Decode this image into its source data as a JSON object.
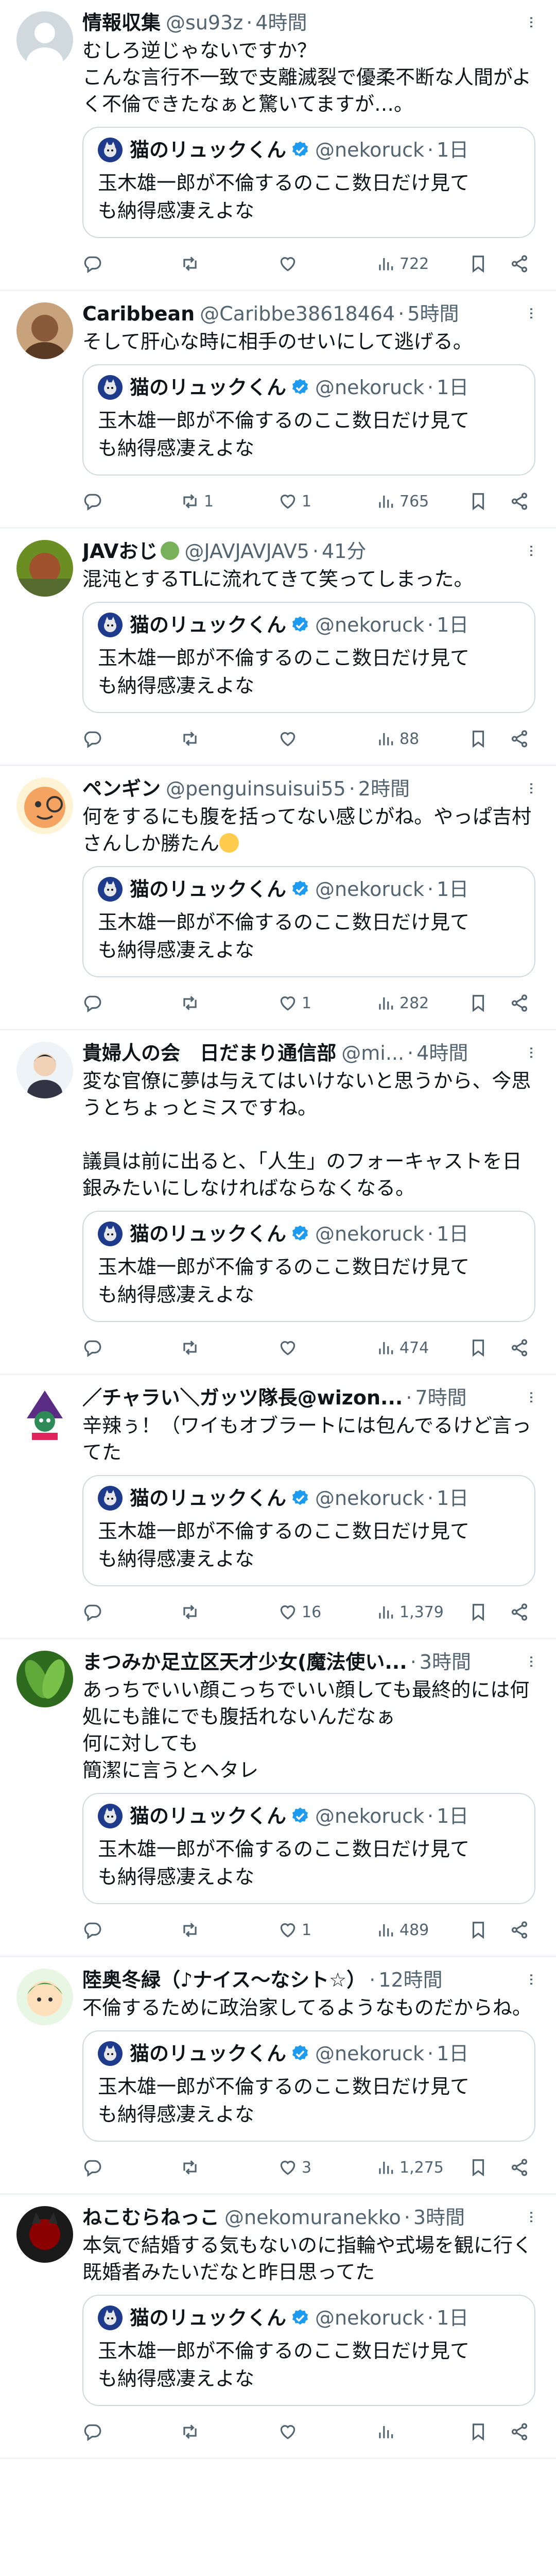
{
  "quoted": {
    "name": "猫のリュックくん",
    "handle": "@nekoruck",
    "sep": "·",
    "time": "1日",
    "text": "玉木雄一郎が不倫するのここ数日だけ見て\nも納得感凄えよな"
  },
  "icons": {
    "more": "more-dots-icon",
    "reply": "reply-icon",
    "retweet": "retweet-icon",
    "like": "heart-icon",
    "views": "views-chart-icon",
    "bookmark": "bookmark-icon",
    "share": "share-icon",
    "verified": "verified-badge-icon"
  },
  "colors": {
    "text": "#0f1419",
    "muted": "#536471",
    "border": "#cfd9de",
    "verified": "#1d9bf0"
  },
  "tweets": [
    {
      "name": "情報収集",
      "handle": "@su93z",
      "sep": "·",
      "time": "4時間",
      "text": "むしろ逆じゃないですか？\nこんな言行不一致で支離滅裂で優柔不断な人間がよく不倫できたなぁと驚いてますが…。",
      "reply_count": "",
      "retweet_count": "",
      "like_count": "",
      "views": "722"
    },
    {
      "name": "Caribbean",
      "handle": "@Caribbe38618464",
      "sep": "·",
      "time": "5時間",
      "text": "そして肝心な時に相手のせいにして逃げる。",
      "reply_count": "",
      "retweet_count": "1",
      "like_count": "1",
      "views": "765"
    },
    {
      "name": "JAVおじ",
      "handle": "@JAVJAVJAV5",
      "sep": "·",
      "time": "41分",
      "text": "混沌とするTLに流れてきて笑ってしまった。",
      "reply_count": "",
      "retweet_count": "",
      "like_count": "",
      "views": "88"
    },
    {
      "name": "ペンギン",
      "handle": "@penguinsuisui55",
      "sep": "·",
      "time": "2時間",
      "text": "何をするにも腹を括ってない感じがね。やっぱ吉村さんしか勝たん",
      "reply_count": "",
      "retweet_count": "",
      "like_count": "1",
      "views": "282"
    },
    {
      "name": "貴婦人の会　日だまり通信部",
      "handle": "@mi...",
      "sep": "·",
      "time": "4時間",
      "text": "変な官僚に夢は与えてはいけないと思うから、今思うとちょっとミスですね。\n\n議員は前に出ると、「人生」のフォーキャストを日銀みたいにしなければならなくなる。",
      "reply_count": "",
      "retweet_count": "",
      "like_count": "",
      "views": "474"
    },
    {
      "name": "／チャラい＼ガッツ隊長@wizon...",
      "handle": "",
      "sep": "·",
      "time": "7時間",
      "text": "辛辣ぅ！（ワイもオブラートには包んでるけど言ってた",
      "reply_count": "",
      "retweet_count": "",
      "like_count": "16",
      "views": "1,379"
    },
    {
      "name": "まつみか足立区天才少女(魔法使い...",
      "handle": "",
      "sep": "·",
      "time": "3時間",
      "text": "あっちでいい顔こっちでいい顔しても最終的には何処にも誰にでも腹括れないんだなぁ\n何に対しても\n簡潔に言うとヘタレ",
      "reply_count": "",
      "retweet_count": "",
      "like_count": "1",
      "views": "489"
    },
    {
      "name": "陸奥冬緑（♪ナイス〜なシト☆）",
      "handle": "",
      "sep": "·",
      "time": "12時間",
      "text": "不倫するために政治家してるようなものだからね。",
      "reply_count": "",
      "retweet_count": "",
      "like_count": "3",
      "views": "1,275"
    },
    {
      "name": "ねこむらねっこ",
      "handle": "@nekomuranekko",
      "sep": "·",
      "time": "3時間",
      "text": "本気で結婚する気もないのに指輪や式場を観に行く既婚者みたいだなと昨日思ってた",
      "reply_count": "",
      "retweet_count": "",
      "like_count": "",
      "views": ""
    }
  ]
}
